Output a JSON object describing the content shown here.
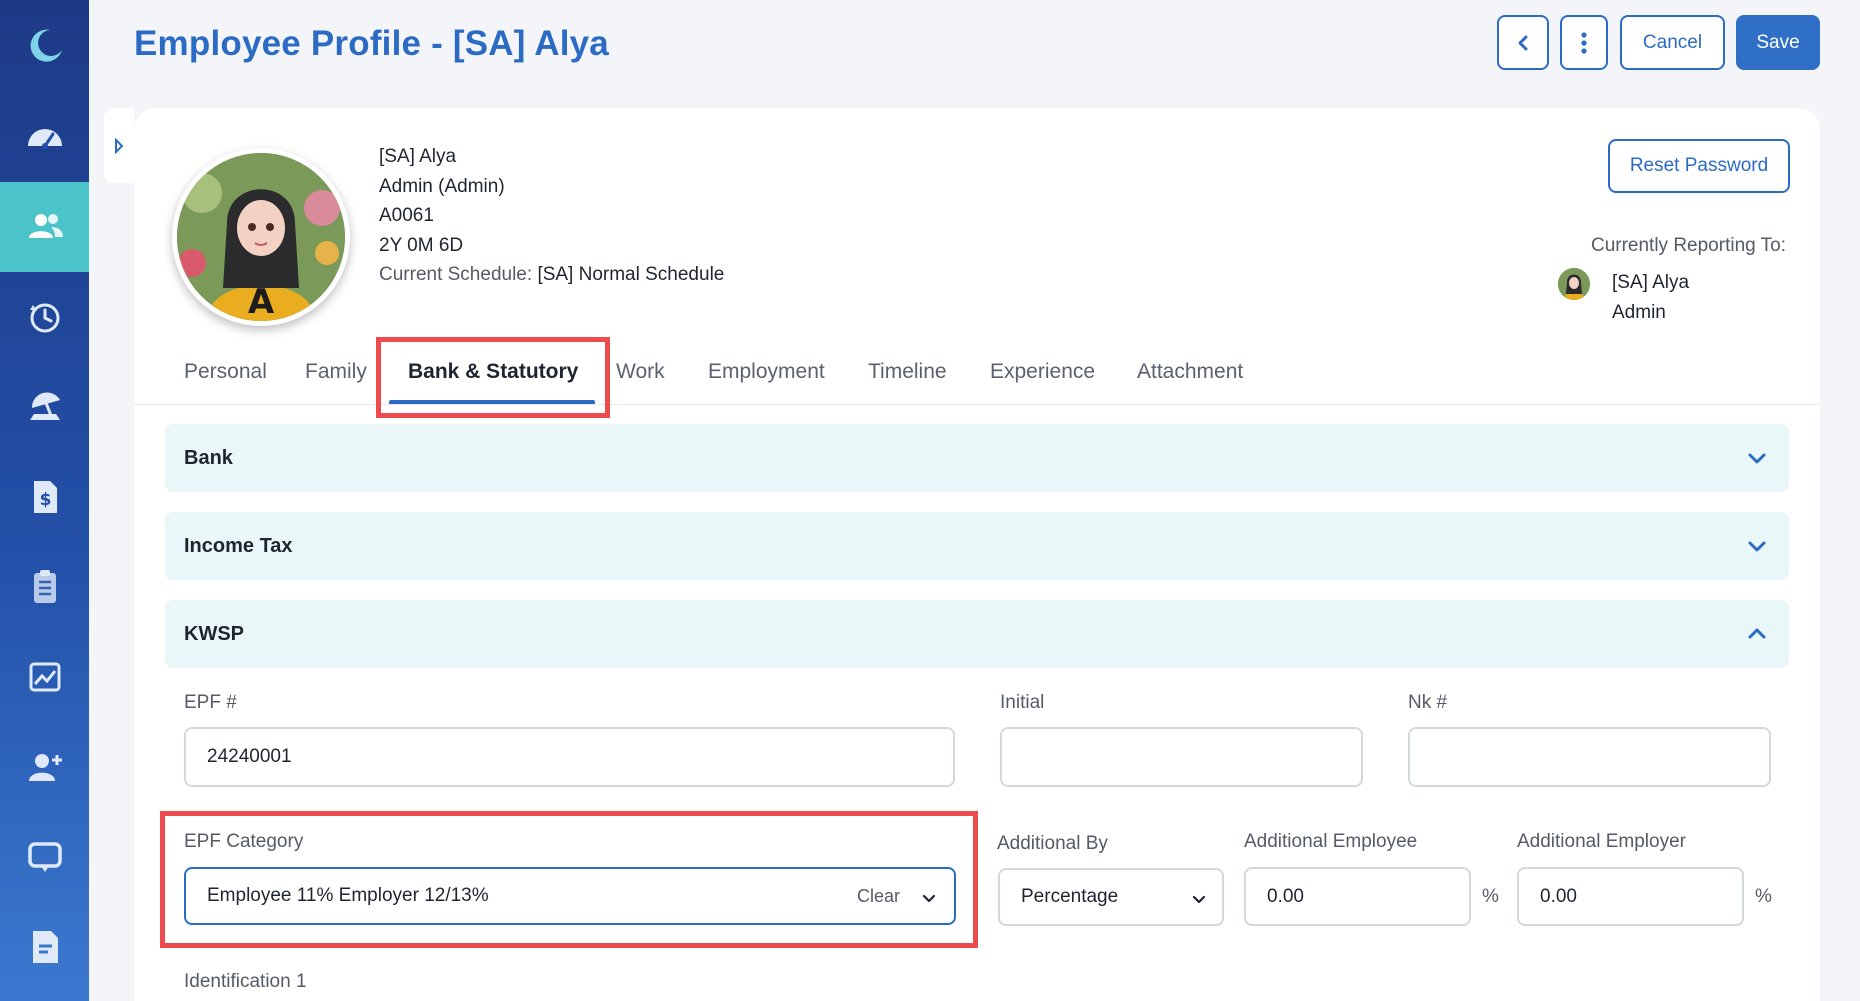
{
  "header": {
    "title": "Employee Profile - [SA] Alya",
    "back_icon": "chevron-left-icon",
    "more_icon": "vertical-dots-icon",
    "cancel_label": "Cancel",
    "save_label": "Save"
  },
  "sidebar": {
    "items": [
      {
        "icon": "moon-logo-icon"
      },
      {
        "icon": "dashboard-gauge-icon"
      },
      {
        "icon": "people-icon",
        "active": true
      },
      {
        "icon": "history-clock-icon"
      },
      {
        "icon": "leave-umbrella-icon"
      },
      {
        "icon": "payroll-dollar-icon"
      },
      {
        "icon": "clipboard-icon"
      },
      {
        "icon": "chart-image-icon"
      },
      {
        "icon": "add-user-icon"
      },
      {
        "icon": "monitor-chat-icon"
      },
      {
        "icon": "document-icon"
      }
    ]
  },
  "profile": {
    "name": "[SA] Alya",
    "role": "Admin (Admin)",
    "employee_id": "A0061",
    "tenure": "2Y 0M 6D",
    "schedule_label": "Current Schedule:",
    "schedule_value": "[SA] Normal Schedule",
    "reset_password_label": "Reset Password",
    "reporting_label": "Currently Reporting To:",
    "reporting_name": "[SA] Alya",
    "reporting_role": "Admin"
  },
  "tabs": [
    {
      "label": "Personal"
    },
    {
      "label": "Family"
    },
    {
      "label": "Bank & Statutory",
      "active": true
    },
    {
      "label": "Work"
    },
    {
      "label": "Employment"
    },
    {
      "label": "Timeline"
    },
    {
      "label": "Experience"
    },
    {
      "label": "Attachment"
    }
  ],
  "sections": {
    "bank": "Bank",
    "income_tax": "Income Tax",
    "kwsp": "KWSP"
  },
  "kwsp": {
    "epf_no_label": "EPF #",
    "epf_no_value": "24240001",
    "initial_label": "Initial",
    "initial_value": "",
    "nk_label": "Nk #",
    "nk_value": "",
    "epf_category_label": "EPF Category",
    "epf_category_value": "Employee 11% Employer 12/13%",
    "clear_label": "Clear",
    "additional_by_label": "Additional By",
    "additional_by_value": "Percentage",
    "additional_employee_label": "Additional Employee",
    "additional_employee_value": "0.00",
    "additional_employer_label": "Additional Employer",
    "additional_employer_value": "0.00",
    "percent_symbol": "%",
    "identification_label": "Identification 1"
  },
  "colors": {
    "brand": "#2c6bc4",
    "sidebar_active": "#4cc2c9",
    "highlight": "#ee4b4f",
    "section_bg": "#eaf7f8"
  }
}
